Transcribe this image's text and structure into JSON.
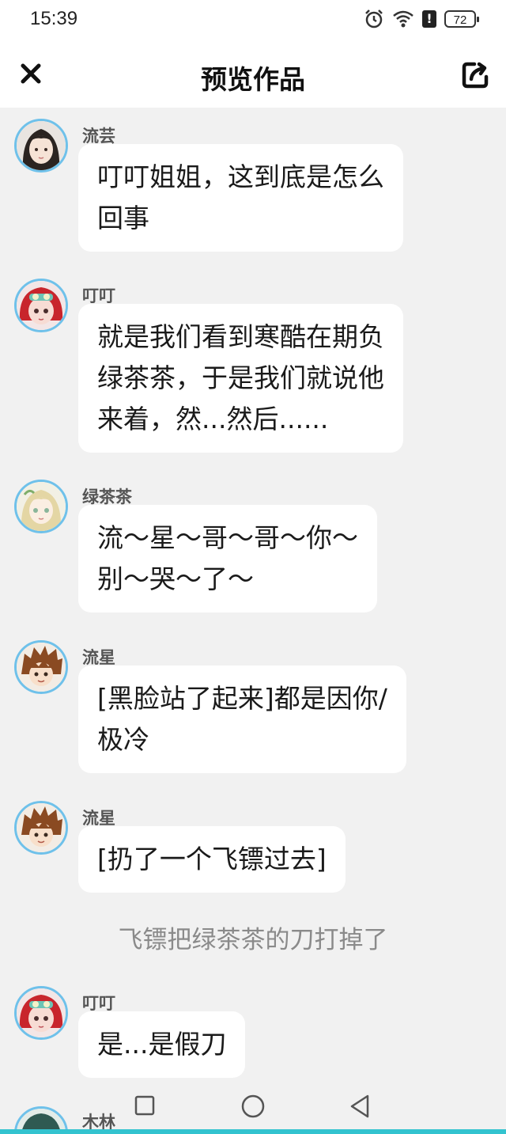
{
  "status_bar": {
    "time": "15:39",
    "battery": "72",
    "alert": "!"
  },
  "nav": {
    "title": "预览作品"
  },
  "messages": [
    {
      "sender": "流芸",
      "text": "叮叮姐姐，这到底是怎么\n回事"
    },
    {
      "sender": "叮叮",
      "text": "就是我们看到寒酷在期负\n绿茶茶，于是我们就说他\n来着，然...然后......"
    },
    {
      "sender": "绿茶茶",
      "text": "流～星～哥～哥～你～\n别～哭～了～"
    },
    {
      "sender": "流星",
      "text": "[黑脸站了起来]都是因你/\n极冷"
    },
    {
      "sender": "流星",
      "text": "[扔了一个飞镖过去]"
    },
    {
      "sender": "叮叮",
      "text": "是...是假刀"
    },
    {
      "sender": "木林"
    }
  ],
  "narration": "飞镖把绿茶茶的刀打掉了",
  "colors": {
    "accent_border": "#6fc1ea",
    "bottom_strip": "#33c3cf",
    "background": "#f1f1f1"
  }
}
